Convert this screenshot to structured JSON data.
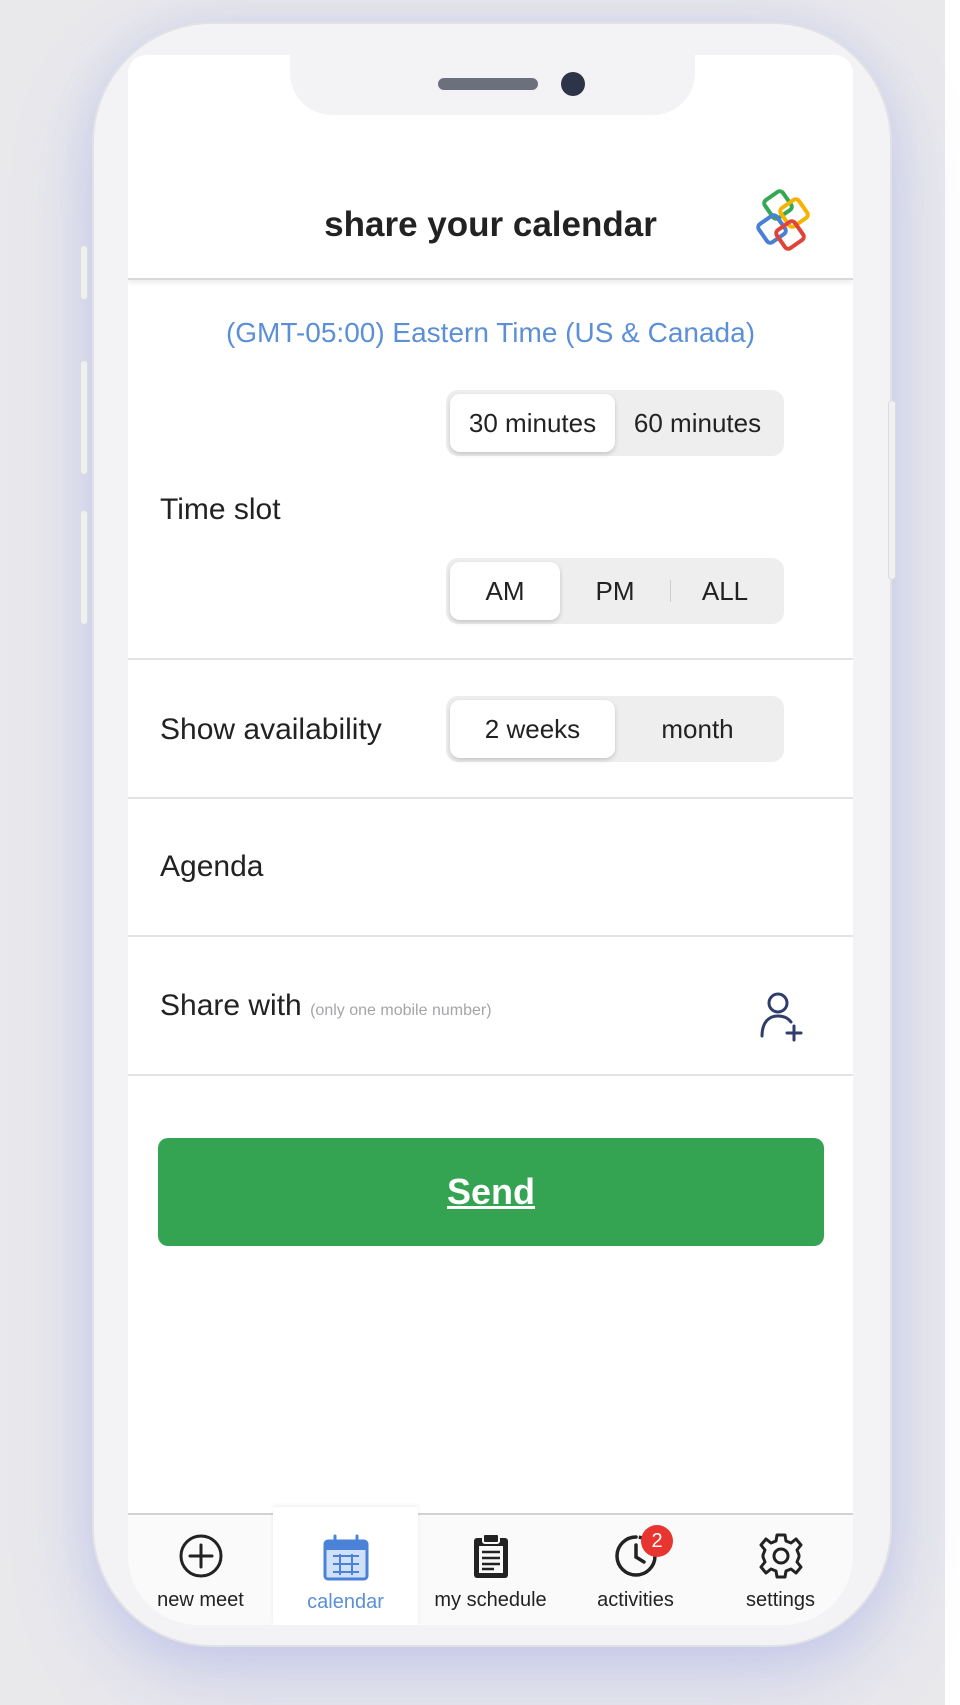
{
  "header": {
    "title": "share your calendar"
  },
  "timezone": "(GMT-05:00) Eastern Time (US & Canada)",
  "time_slot": {
    "label": "Time slot",
    "duration_options": [
      "30 minutes",
      "60 minutes"
    ],
    "duration_selected": "30 minutes",
    "period_options": [
      "AM",
      "PM",
      "ALL"
    ],
    "period_selected": "AM"
  },
  "availability": {
    "label": "Show availability",
    "options": [
      "2 weeks",
      "month"
    ],
    "selected": "2 weeks"
  },
  "agenda": {
    "label": "Agenda"
  },
  "share_with": {
    "label": "Share with",
    "hint": "(only one mobile number)"
  },
  "send_button": {
    "label": "Send"
  },
  "tabs": [
    {
      "label": "new meet",
      "icon": "plus-circle-icon"
    },
    {
      "label": "calendar",
      "icon": "calendar-icon",
      "active": true
    },
    {
      "label": "my schedule",
      "icon": "clipboard-icon"
    },
    {
      "label": "activities",
      "icon": "clock-icon",
      "badge": "2"
    },
    {
      "label": "settings",
      "icon": "gear-icon"
    }
  ],
  "colors": {
    "accent_blue": "#5b8fd6",
    "send_green": "#34a352",
    "badge_red": "#e8352f"
  }
}
